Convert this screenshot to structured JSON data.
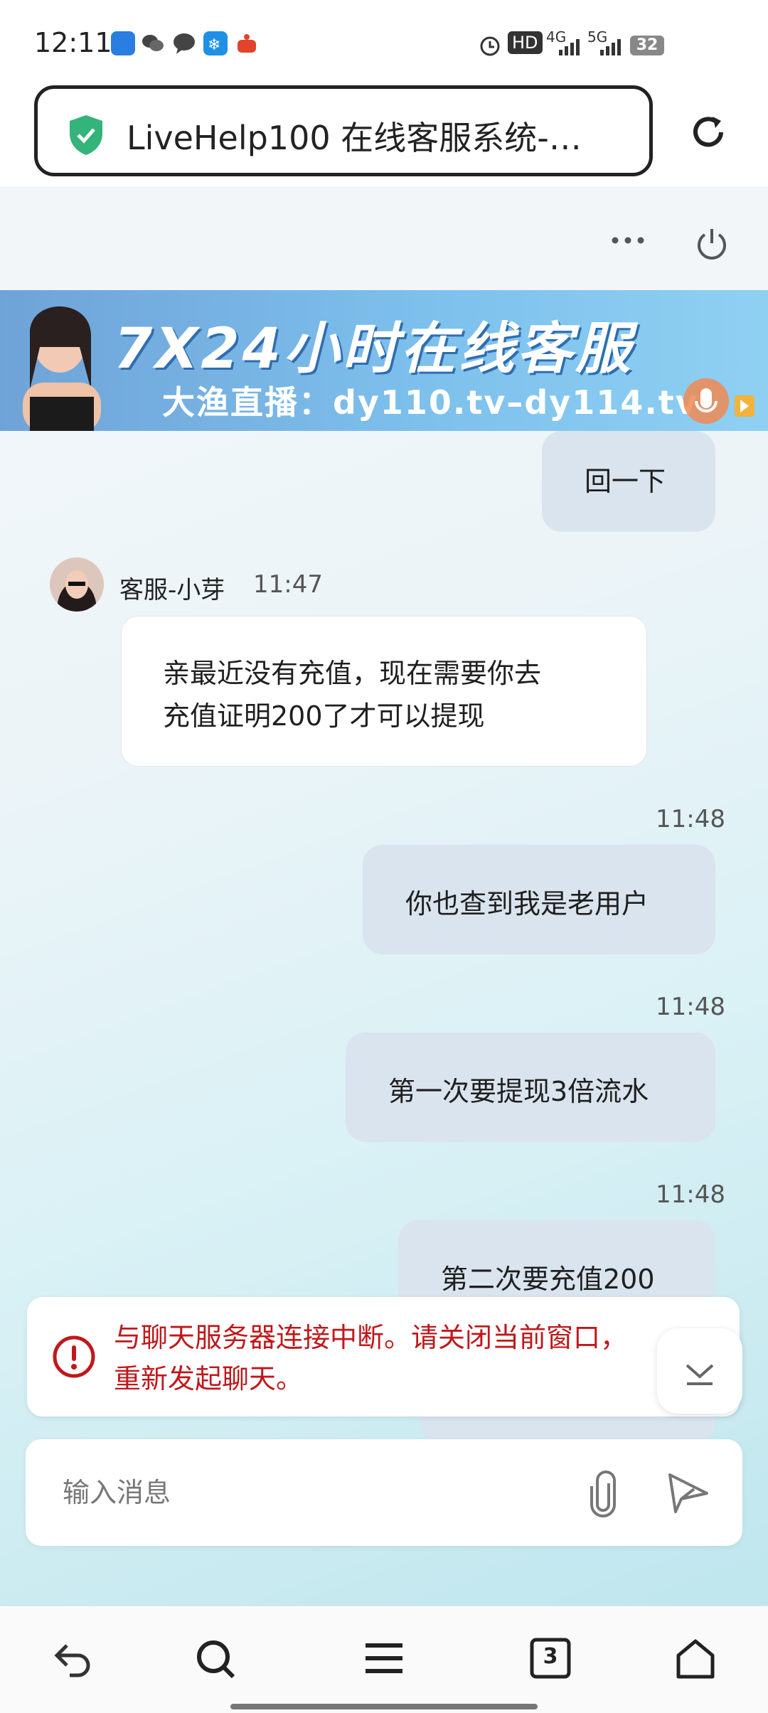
{
  "status_bar": {
    "time": "12:11",
    "network_hd": "HD",
    "network_4g": "4G",
    "network_5g": "5G",
    "battery": "32",
    "icons": [
      "app-icon-blue",
      "wechat-icon",
      "message-icon",
      "snowflake-app-icon",
      "red-app-icon",
      "alarm-icon"
    ]
  },
  "browser": {
    "url_title": "LiveHelp100 在线客服系统-…",
    "security_icon": "shield-check-icon",
    "reload_icon": "reload-icon"
  },
  "chat_header": {
    "more_icon": "more-dots-icon",
    "power_icon": "power-icon"
  },
  "banner": {
    "title": "7X24小时在线客服",
    "subtitle": "大渔直播：dy110.tv–dy114.tv"
  },
  "messages": [
    {
      "from": "me",
      "text": "回一下"
    },
    {
      "from": "agent",
      "agent_name": "客服-小芽",
      "time": "11:47",
      "text_lines": [
        "亲最近没有充值，现在需要你去",
        "充值证明200了才可以提现"
      ]
    },
    {
      "from": "me",
      "time": "11:48",
      "text": "你也查到我是老用户"
    },
    {
      "from": "me",
      "time": "11:48",
      "text": "第一次要提现3倍流水"
    },
    {
      "from": "me",
      "time": "11:48",
      "text": "第二次要充值200"
    }
  ],
  "alert": {
    "line1": "与聊天服务器连接中断。请关闭当前窗口，",
    "line2": "重新发起聊天。",
    "color": "#c0181b"
  },
  "composer": {
    "placeholder": "输入消息"
  },
  "bottom_nav": {
    "tab_count": "3",
    "items": [
      "back-icon",
      "search-icon",
      "menu-icon",
      "tabs-icon",
      "home-icon"
    ]
  }
}
